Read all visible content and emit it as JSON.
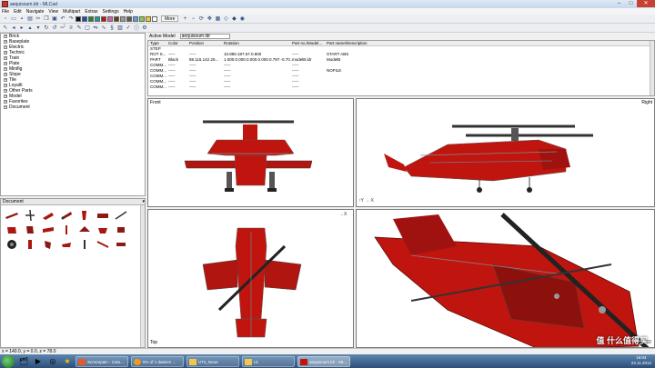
{
  "window": {
    "title": "aequisoum.ldr - MLCad"
  },
  "menu": [
    "File",
    "Edit",
    "Navigate",
    "View",
    "Multipart",
    "Extras",
    "Settings",
    "Help"
  ],
  "toolbar": {
    "more_label": "More"
  },
  "tree": [
    "Brick",
    "Baseplate",
    "Electric",
    "Technic",
    "Train",
    "Plate",
    "Minifig",
    "Slope",
    "Tile",
    "Loyalti",
    "Other Parts",
    "Model",
    "Favorites",
    "Document"
  ],
  "parts_panel": {
    "header": "Document"
  },
  "model_bar": {
    "label": "Active Model",
    "value": "aequisoum.ldr"
  },
  "table": {
    "headers": [
      "Type",
      "Color",
      "Position",
      "Rotation",
      "Part no./Model...",
      "Part name/Description"
    ],
    "rows": [
      [
        "STEP",
        "",
        "",
        "",
        "",
        ""
      ],
      [
        "ROT S...",
        "-----",
        "-----",
        "10.890.187.67.0.800",
        "-----",
        "START ABS"
      ],
      [
        "PART",
        "Black",
        "88.115.142.25...",
        "1.000.0.000.0.000.0.000.0.797.-0.70...",
        "modelB.ldr",
        "ModelB"
      ],
      [
        "COMM...",
        "-----",
        "-----",
        "-----",
        "-----",
        ""
      ],
      [
        "COMM...",
        "-----",
        "-----",
        "-----",
        "-----",
        "NOFILE"
      ],
      [
        "COMM...",
        "-----",
        "-----",
        "-----",
        "-----",
        ""
      ],
      [
        "COMM...",
        "-----",
        "-----",
        "-----",
        "-----",
        ""
      ],
      [
        "COMM...",
        "-----",
        "-----",
        "-----",
        "-----",
        ""
      ]
    ]
  },
  "viewports": {
    "front": "Front",
    "right": "Right",
    "top": "Top",
    "threed": "3D"
  },
  "status": "x = 140.0, y = 0.0, z = 78.0",
  "taskbar": {
    "items": [
      "Screenpain - Cato...",
      "5% of 1 dateien ...",
      "UT2_Neue",
      "Lk",
      "aequisoum.ldr - ML..."
    ],
    "time": "16:04",
    "date": "23.11.2012"
  },
  "watermark": "值 什么值得买",
  "colors": {
    "model_red": "#c0150f",
    "accent": "#2a4a7a"
  }
}
